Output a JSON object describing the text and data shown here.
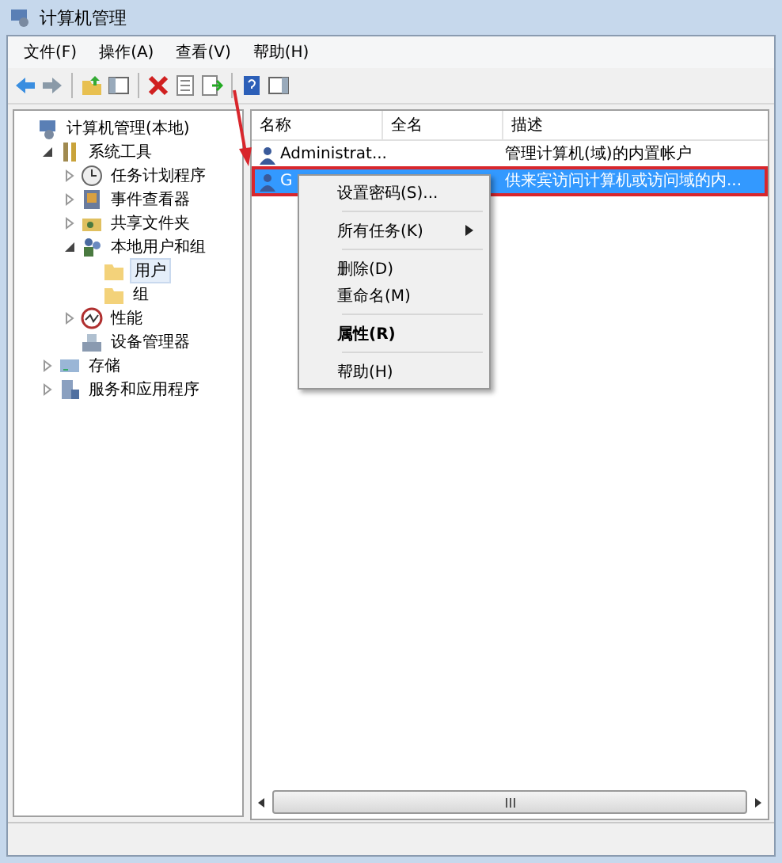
{
  "window": {
    "title": "计算机管理"
  },
  "menu": [
    "文件(F)",
    "操作(A)",
    "查看(V)",
    "帮助(H)"
  ],
  "tree": [
    {
      "label": "计算机管理(本地)",
      "kind": "computer",
      "selected": false,
      "children": [
        {
          "label": "系统工具",
          "kind": "tools",
          "expanded": true,
          "selected": false,
          "children": [
            {
              "label": "任务计划程序",
              "kind": "clock",
              "expanded": false,
              "selected": false
            },
            {
              "label": "事件查看器",
              "kind": "viewer",
              "expanded": false,
              "selected": false
            },
            {
              "label": "共享文件夹",
              "kind": "share",
              "expanded": false,
              "selected": false
            },
            {
              "label": "本地用户和组",
              "kind": "users",
              "expanded": true,
              "selected": false,
              "children": [
                {
                  "label": "用户",
                  "kind": "folder",
                  "selected": true
                },
                {
                  "label": "组",
                  "kind": "folder",
                  "selected": false
                }
              ]
            },
            {
              "label": "性能",
              "kind": "perf",
              "expanded": false,
              "selected": false
            },
            {
              "label": "设备管理器",
              "kind": "device",
              "selected": false
            }
          ]
        },
        {
          "label": "存储",
          "kind": "storage",
          "expanded": false,
          "selected": false
        },
        {
          "label": "服务和应用程序",
          "kind": "services",
          "expanded": false,
          "selected": false
        }
      ]
    }
  ],
  "table": {
    "columns": [
      "名称",
      "全名",
      "描述"
    ],
    "rows": [
      {
        "name": "Administrat...",
        "description": "管理计算机(域)的内置帐户",
        "selected": false
      },
      {
        "name": "G",
        "description": "供来宾访问计算机或访问域的内...",
        "selected": true
      }
    ]
  },
  "context_menu": [
    {
      "kind": "item",
      "label": "设置密码(S)...",
      "bold": false,
      "submenu": false
    },
    {
      "kind": "separator"
    },
    {
      "kind": "item",
      "label": "所有任务(K)",
      "bold": false,
      "submenu": true
    },
    {
      "kind": "separator"
    },
    {
      "kind": "item",
      "label": "删除(D)",
      "bold": false,
      "submenu": false
    },
    {
      "kind": "item",
      "label": "重命名(M)",
      "bold": false,
      "submenu": false
    },
    {
      "kind": "separator"
    },
    {
      "kind": "item",
      "label": "属性(R)",
      "bold": true,
      "submenu": false
    },
    {
      "kind": "separator"
    },
    {
      "kind": "item",
      "label": "帮助(H)",
      "bold": false,
      "submenu": false
    }
  ],
  "annotations": {
    "arrow": true,
    "highlight_box": true
  }
}
